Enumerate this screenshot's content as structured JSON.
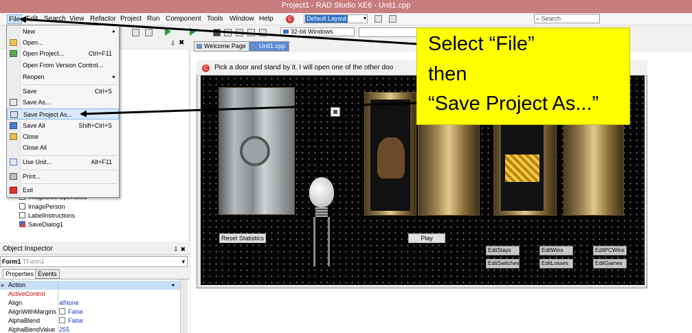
{
  "window": {
    "title": "Project1 - RAD Studio XE6 - Unit1.cpp"
  },
  "menubar": {
    "items": [
      "File",
      "Edit",
      "Search",
      "View",
      "Refactor",
      "Project",
      "Run",
      "Component",
      "Tools",
      "Window",
      "Help"
    ],
    "layout_select": "Default Layout",
    "search_placeholder": "Search"
  },
  "toolbar": {
    "platform_select": "32-bit Windows"
  },
  "file_menu": {
    "items": [
      {
        "label": "New",
        "shortcut": "",
        "submenu": true,
        "icon": "none"
      },
      {
        "label": "Open...",
        "shortcut": "",
        "icon": "open-folder-icon"
      },
      {
        "label": "Open Project...",
        "shortcut": "Ctrl+F11",
        "icon": "open-project-icon"
      },
      {
        "label": "Open From Version Control...",
        "shortcut": "",
        "icon": "none"
      },
      {
        "label": "Reopen",
        "shortcut": "",
        "submenu": true,
        "icon": "none"
      },
      {
        "label": "Save",
        "shortcut": "Ctrl+S",
        "icon": "floppy-disk-icon"
      },
      {
        "label": "Save As...",
        "shortcut": "",
        "icon": "save-as-icon"
      },
      {
        "label": "Save Project As...",
        "shortcut": "",
        "icon": "save-project-as-icon",
        "highlighted": true
      },
      {
        "label": "Save All",
        "shortcut": "Shift+Ctrl+S",
        "icon": "save-all-icon"
      },
      {
        "label": "Close",
        "shortcut": "",
        "icon": "close-icon"
      },
      {
        "label": "Close All",
        "shortcut": "",
        "icon": "close-all-icon"
      },
      {
        "label": "Use Unit...",
        "shortcut": "Alt+F11",
        "icon": "use-unit-icon"
      },
      {
        "label": "Print...",
        "shortcut": "",
        "icon": "printer-icon"
      },
      {
        "label": "Exit",
        "shortcut": "",
        "icon": "exit-icon"
      }
    ]
  },
  "structure_tree": {
    "items": [
      "ImageDoorOpenGold",
      "ImagePerson",
      "LabelInstructions",
      "SaveDialog1"
    ]
  },
  "object_inspector": {
    "title": "Object Inspector",
    "selected_object": "Form1",
    "selected_type": "TForm1",
    "tabs": [
      "Properties",
      "Events"
    ],
    "properties": [
      {
        "name": "Action",
        "value": ""
      },
      {
        "name": "ActiveControl",
        "value": ""
      },
      {
        "name": "Align",
        "value": "alNone"
      },
      {
        "name": "AlignWithMargins",
        "value": "False"
      },
      {
        "name": "AlphaBlend",
        "value": "False"
      },
      {
        "name": "AlphaBlendValue",
        "value": "255"
      }
    ]
  },
  "designer": {
    "tabs": [
      "Welcome Page",
      "Unit1.cpp"
    ],
    "form_caption": "Pick a door and stand by it.  I will open one of the other doo",
    "buttons": {
      "reset": "Reset Statistics",
      "play": "Play"
    },
    "edits": [
      "EditStays",
      "EditWins",
      "EditPCWins",
      "EditSwitches",
      "EditLosses",
      "EditGames"
    ]
  },
  "callout": {
    "line1": "Select “File”",
    "line2": "then",
    "line3": "“Save Project As...”",
    "color": "#ffff00"
  }
}
